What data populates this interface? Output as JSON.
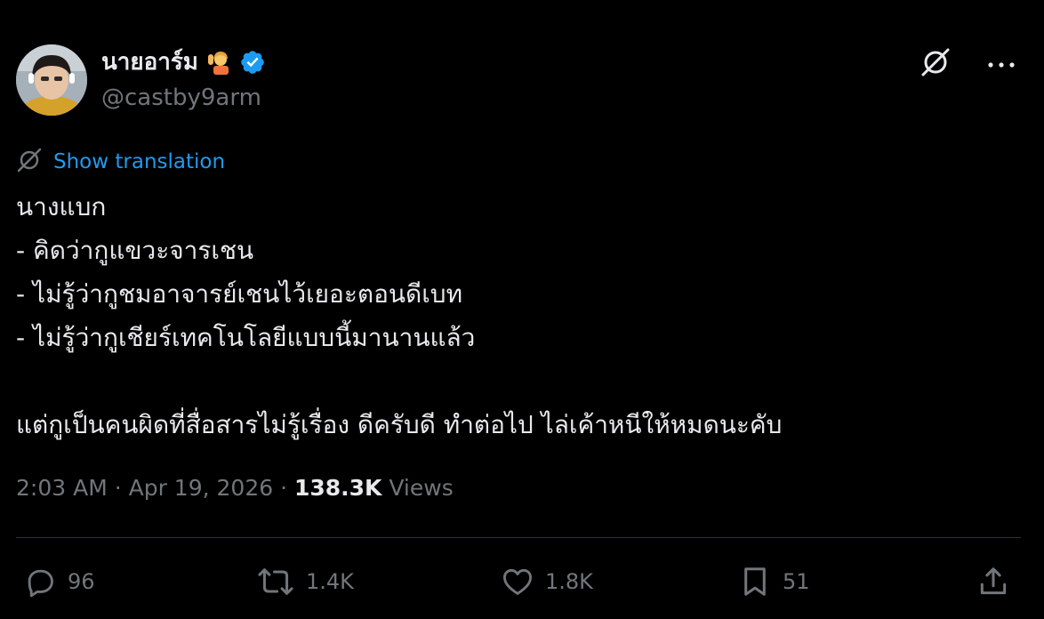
{
  "author": {
    "display_name": "นายอาร์ม",
    "handle": "@castby9arm",
    "verified": true,
    "emoji": "raising-hand-emoji"
  },
  "header": {
    "icons": [
      "grok-icon",
      "more-icon"
    ],
    "more_label": "···"
  },
  "translation": {
    "label": "Show translation",
    "icon": "translate-globe-icon"
  },
  "tweet": {
    "lines": [
      "นางแบก",
      "- คิดว่ากูแขวะจารเชน",
      "- ไม่รู้ว่ากูชมอาจารย์เชนไว้เยอะตอนดีเบท",
      "- ไม่รู้ว่ากูเชียร์เทคโนโลยีแบบนี้มานานแล้ว",
      "",
      "แต่กูเป็นคนผิดที่สื่อสารไม่รู้เรื่อง ดีครับดี ทำต่อไป ไล่เค้าหนีให้หมดนะคับ"
    ]
  },
  "meta": {
    "time": "2:03 AM",
    "sep1": " · ",
    "date": "Apr 19, 2026",
    "sep2": " · ",
    "views_count": "138.3K",
    "views_label": " Views"
  },
  "actions": {
    "replies": "96",
    "reposts": "1.4K",
    "likes": "1.8K",
    "bookmarks": "51"
  },
  "colors": {
    "background": "#000000",
    "text_primary": "#e7e9ea",
    "text_secondary": "#71767b",
    "link_blue": "#1d9bf0",
    "verified_blue": "#1d9bf0",
    "divider": "#2f3336"
  }
}
